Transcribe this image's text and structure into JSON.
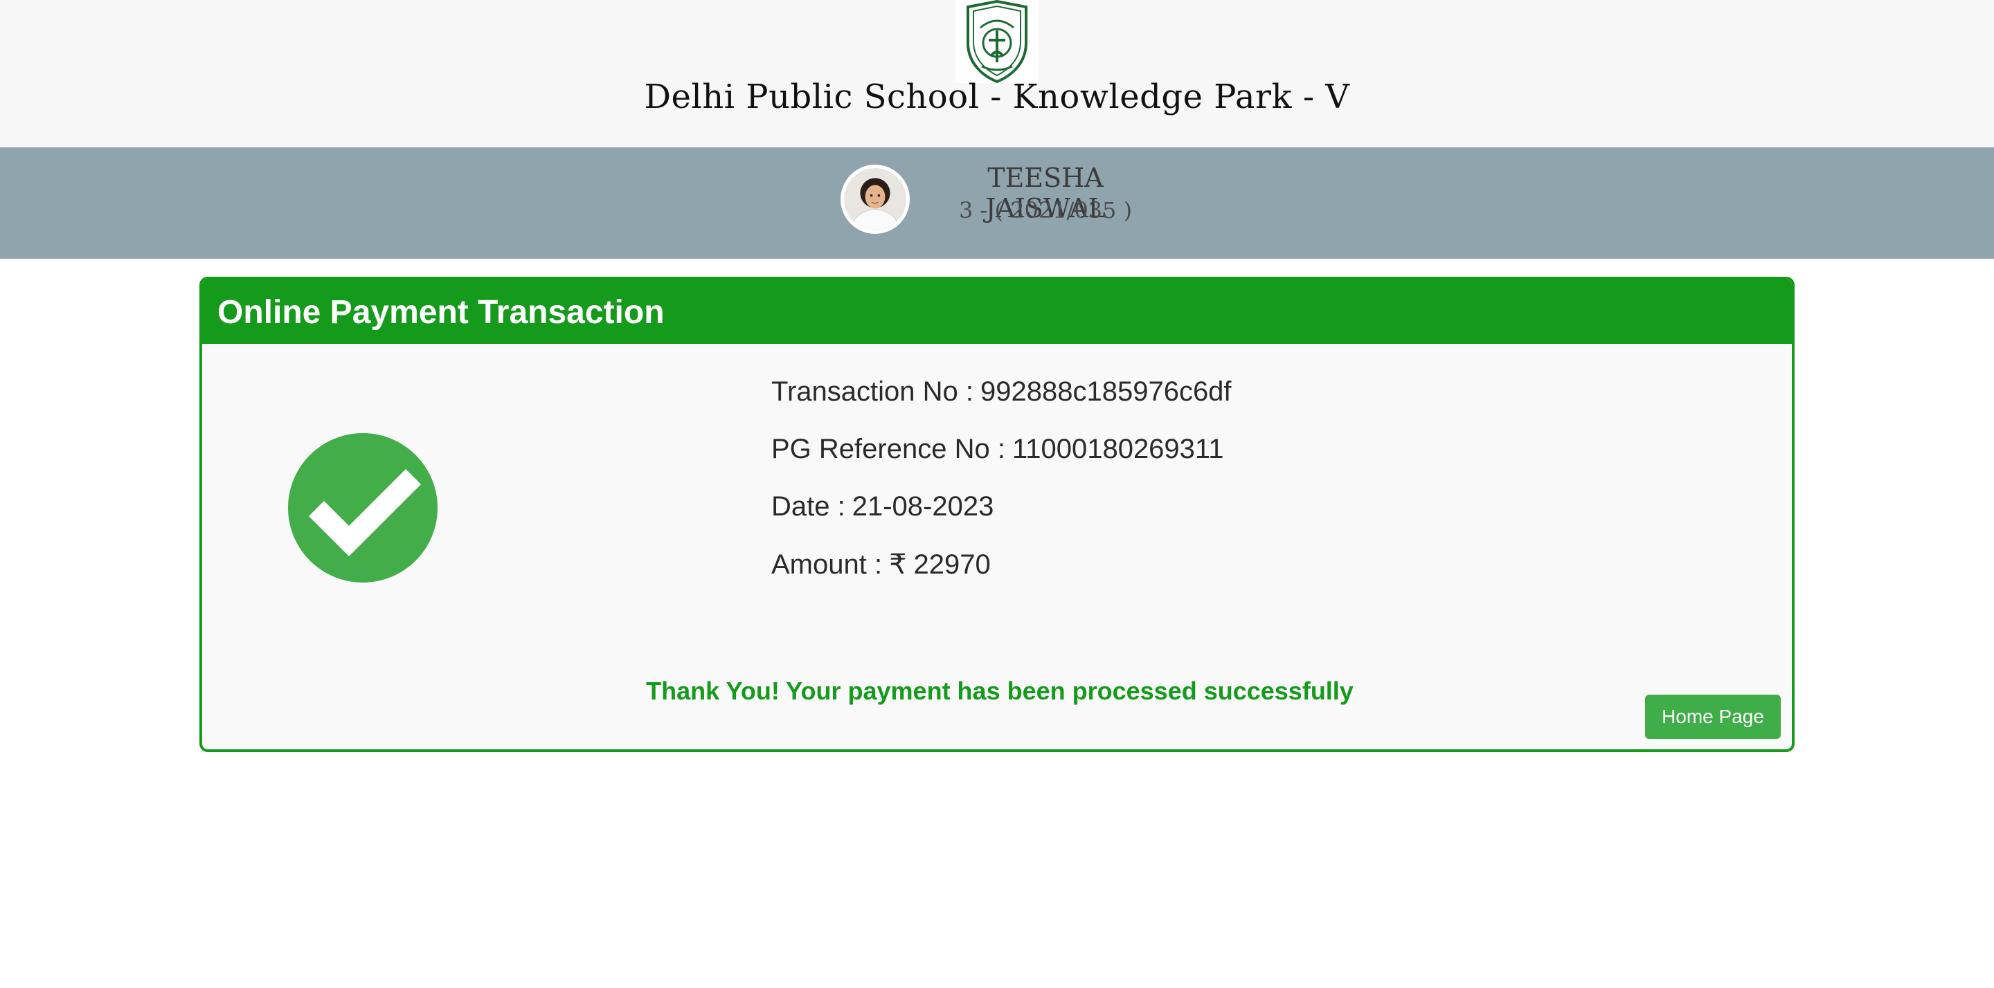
{
  "header": {
    "school_name": "Delhi Public School - Knowledge Park - V",
    "logo_icon": "school-crest-icon"
  },
  "student": {
    "name": "TEESHA JAISWAL",
    "class_info": "3 - ( 2021/035 )"
  },
  "panel": {
    "title": "Online Payment Transaction",
    "status_icon": "check-circle-icon",
    "transaction_label": "Transaction No :",
    "transaction_value": "992888c185976c6df",
    "pg_ref_label": "PG Reference No :",
    "pg_ref_value": "11000180269311",
    "date_label": "Date :",
    "date_value": "21-08-2023",
    "amount_label": "Amount :",
    "currency_symbol": "₹",
    "amount_value": "22970",
    "thank_you": "Thank You! Your payment has been processed successfully",
    "home_button": "Home Page"
  },
  "colors": {
    "accent_green": "#149b1b",
    "success_green": "#43ad49",
    "band_gray": "#8fa4ad"
  }
}
